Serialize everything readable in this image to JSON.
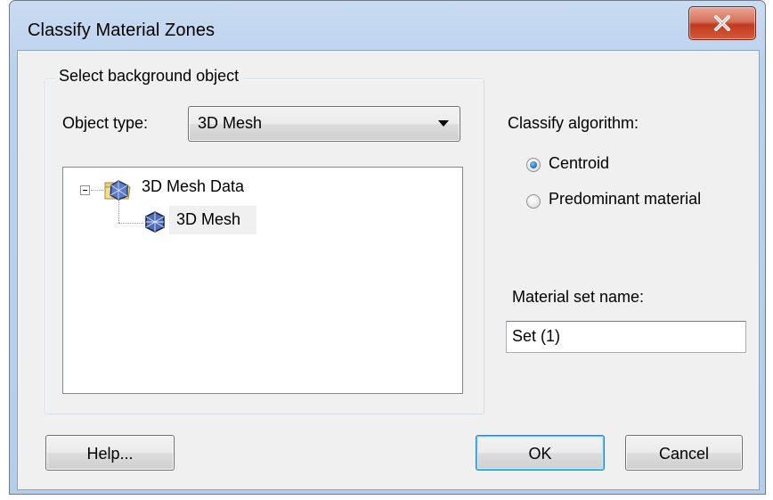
{
  "window": {
    "title": "Classify Material Zones",
    "close_icon": "close-icon"
  },
  "background_group": {
    "label": "Select background object",
    "object_type_label": "Object type:",
    "object_type_value": "3D Mesh",
    "tree": {
      "root": {
        "label": "3D Mesh Data",
        "icon": "mesh-folder-icon",
        "expanded": true
      },
      "child": {
        "label": "3D Mesh",
        "icon": "mesh-icon",
        "selected": true
      }
    }
  },
  "algorithm": {
    "label": "Classify algorithm:",
    "options": [
      {
        "label": "Centroid",
        "checked": true
      },
      {
        "label": "Predominant material",
        "checked": false
      }
    ]
  },
  "material_set": {
    "label": "Material set name:",
    "value": "Set (1)"
  },
  "buttons": {
    "help": "Help...",
    "ok": "OK",
    "cancel": "Cancel"
  },
  "colors": {
    "title_bar": "#bcd2ec",
    "close_button": "#c13a1f",
    "dialog_bg": "#f0f0f0",
    "radio_selected": "#1d6fb8"
  }
}
